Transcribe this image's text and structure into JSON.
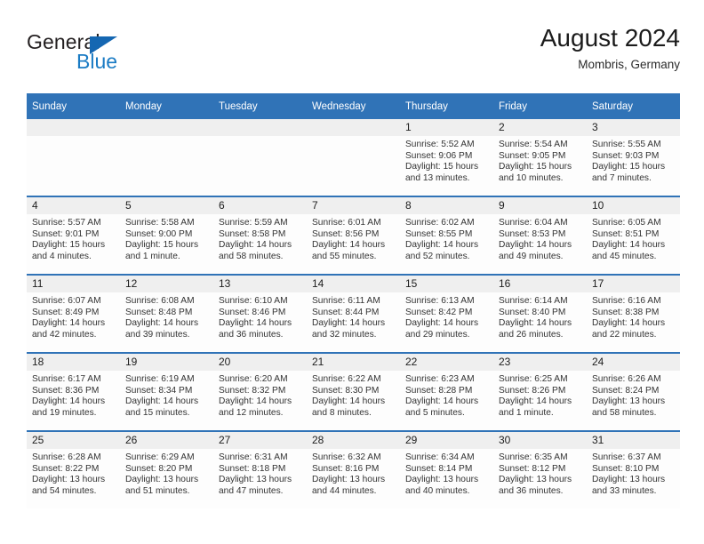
{
  "brand": {
    "word_general": "General",
    "word_blue": "Blue",
    "triangle_color": "#1567b2",
    "blue_color": "#1a7bc4"
  },
  "header": {
    "title": "August 2024",
    "subtitle": "Mombris, Germany"
  },
  "theme": {
    "header_blue": "#3073b7",
    "daynum_band": "#efefef",
    "cell_background": "#fdfdfd"
  },
  "calendar": {
    "weekday_headers": [
      "Sunday",
      "Monday",
      "Tuesday",
      "Wednesday",
      "Thursday",
      "Friday",
      "Saturday"
    ],
    "weeks": [
      [
        {
          "blank": true
        },
        {
          "blank": true
        },
        {
          "blank": true
        },
        {
          "blank": true
        },
        {
          "day": "1",
          "sunrise": "Sunrise: 5:52 AM",
          "sunset": "Sunset: 9:06 PM",
          "daylight": "Daylight: 15 hours and 13 minutes."
        },
        {
          "day": "2",
          "sunrise": "Sunrise: 5:54 AM",
          "sunset": "Sunset: 9:05 PM",
          "daylight": "Daylight: 15 hours and 10 minutes."
        },
        {
          "day": "3",
          "sunrise": "Sunrise: 5:55 AM",
          "sunset": "Sunset: 9:03 PM",
          "daylight": "Daylight: 15 hours and 7 minutes."
        }
      ],
      [
        {
          "day": "4",
          "sunrise": "Sunrise: 5:57 AM",
          "sunset": "Sunset: 9:01 PM",
          "daylight": "Daylight: 15 hours and 4 minutes."
        },
        {
          "day": "5",
          "sunrise": "Sunrise: 5:58 AM",
          "sunset": "Sunset: 9:00 PM",
          "daylight": "Daylight: 15 hours and 1 minute."
        },
        {
          "day": "6",
          "sunrise": "Sunrise: 5:59 AM",
          "sunset": "Sunset: 8:58 PM",
          "daylight": "Daylight: 14 hours and 58 minutes."
        },
        {
          "day": "7",
          "sunrise": "Sunrise: 6:01 AM",
          "sunset": "Sunset: 8:56 PM",
          "daylight": "Daylight: 14 hours and 55 minutes."
        },
        {
          "day": "8",
          "sunrise": "Sunrise: 6:02 AM",
          "sunset": "Sunset: 8:55 PM",
          "daylight": "Daylight: 14 hours and 52 minutes."
        },
        {
          "day": "9",
          "sunrise": "Sunrise: 6:04 AM",
          "sunset": "Sunset: 8:53 PM",
          "daylight": "Daylight: 14 hours and 49 minutes."
        },
        {
          "day": "10",
          "sunrise": "Sunrise: 6:05 AM",
          "sunset": "Sunset: 8:51 PM",
          "daylight": "Daylight: 14 hours and 45 minutes."
        }
      ],
      [
        {
          "day": "11",
          "sunrise": "Sunrise: 6:07 AM",
          "sunset": "Sunset: 8:49 PM",
          "daylight": "Daylight: 14 hours and 42 minutes."
        },
        {
          "day": "12",
          "sunrise": "Sunrise: 6:08 AM",
          "sunset": "Sunset: 8:48 PM",
          "daylight": "Daylight: 14 hours and 39 minutes."
        },
        {
          "day": "13",
          "sunrise": "Sunrise: 6:10 AM",
          "sunset": "Sunset: 8:46 PM",
          "daylight": "Daylight: 14 hours and 36 minutes."
        },
        {
          "day": "14",
          "sunrise": "Sunrise: 6:11 AM",
          "sunset": "Sunset: 8:44 PM",
          "daylight": "Daylight: 14 hours and 32 minutes."
        },
        {
          "day": "15",
          "sunrise": "Sunrise: 6:13 AM",
          "sunset": "Sunset: 8:42 PM",
          "daylight": "Daylight: 14 hours and 29 minutes."
        },
        {
          "day": "16",
          "sunrise": "Sunrise: 6:14 AM",
          "sunset": "Sunset: 8:40 PM",
          "daylight": "Daylight: 14 hours and 26 minutes."
        },
        {
          "day": "17",
          "sunrise": "Sunrise: 6:16 AM",
          "sunset": "Sunset: 8:38 PM",
          "daylight": "Daylight: 14 hours and 22 minutes."
        }
      ],
      [
        {
          "day": "18",
          "sunrise": "Sunrise: 6:17 AM",
          "sunset": "Sunset: 8:36 PM",
          "daylight": "Daylight: 14 hours and 19 minutes."
        },
        {
          "day": "19",
          "sunrise": "Sunrise: 6:19 AM",
          "sunset": "Sunset: 8:34 PM",
          "daylight": "Daylight: 14 hours and 15 minutes."
        },
        {
          "day": "20",
          "sunrise": "Sunrise: 6:20 AM",
          "sunset": "Sunset: 8:32 PM",
          "daylight": "Daylight: 14 hours and 12 minutes."
        },
        {
          "day": "21",
          "sunrise": "Sunrise: 6:22 AM",
          "sunset": "Sunset: 8:30 PM",
          "daylight": "Daylight: 14 hours and 8 minutes."
        },
        {
          "day": "22",
          "sunrise": "Sunrise: 6:23 AM",
          "sunset": "Sunset: 8:28 PM",
          "daylight": "Daylight: 14 hours and 5 minutes."
        },
        {
          "day": "23",
          "sunrise": "Sunrise: 6:25 AM",
          "sunset": "Sunset: 8:26 PM",
          "daylight": "Daylight: 14 hours and 1 minute."
        },
        {
          "day": "24",
          "sunrise": "Sunrise: 6:26 AM",
          "sunset": "Sunset: 8:24 PM",
          "daylight": "Daylight: 13 hours and 58 minutes."
        }
      ],
      [
        {
          "day": "25",
          "sunrise": "Sunrise: 6:28 AM",
          "sunset": "Sunset: 8:22 PM",
          "daylight": "Daylight: 13 hours and 54 minutes."
        },
        {
          "day": "26",
          "sunrise": "Sunrise: 6:29 AM",
          "sunset": "Sunset: 8:20 PM",
          "daylight": "Daylight: 13 hours and 51 minutes."
        },
        {
          "day": "27",
          "sunrise": "Sunrise: 6:31 AM",
          "sunset": "Sunset: 8:18 PM",
          "daylight": "Daylight: 13 hours and 47 minutes."
        },
        {
          "day": "28",
          "sunrise": "Sunrise: 6:32 AM",
          "sunset": "Sunset: 8:16 PM",
          "daylight": "Daylight: 13 hours and 44 minutes."
        },
        {
          "day": "29",
          "sunrise": "Sunrise: 6:34 AM",
          "sunset": "Sunset: 8:14 PM",
          "daylight": "Daylight: 13 hours and 40 minutes."
        },
        {
          "day": "30",
          "sunrise": "Sunrise: 6:35 AM",
          "sunset": "Sunset: 8:12 PM",
          "daylight": "Daylight: 13 hours and 36 minutes."
        },
        {
          "day": "31",
          "sunrise": "Sunrise: 6:37 AM",
          "sunset": "Sunset: 8:10 PM",
          "daylight": "Daylight: 13 hours and 33 minutes."
        }
      ]
    ]
  }
}
